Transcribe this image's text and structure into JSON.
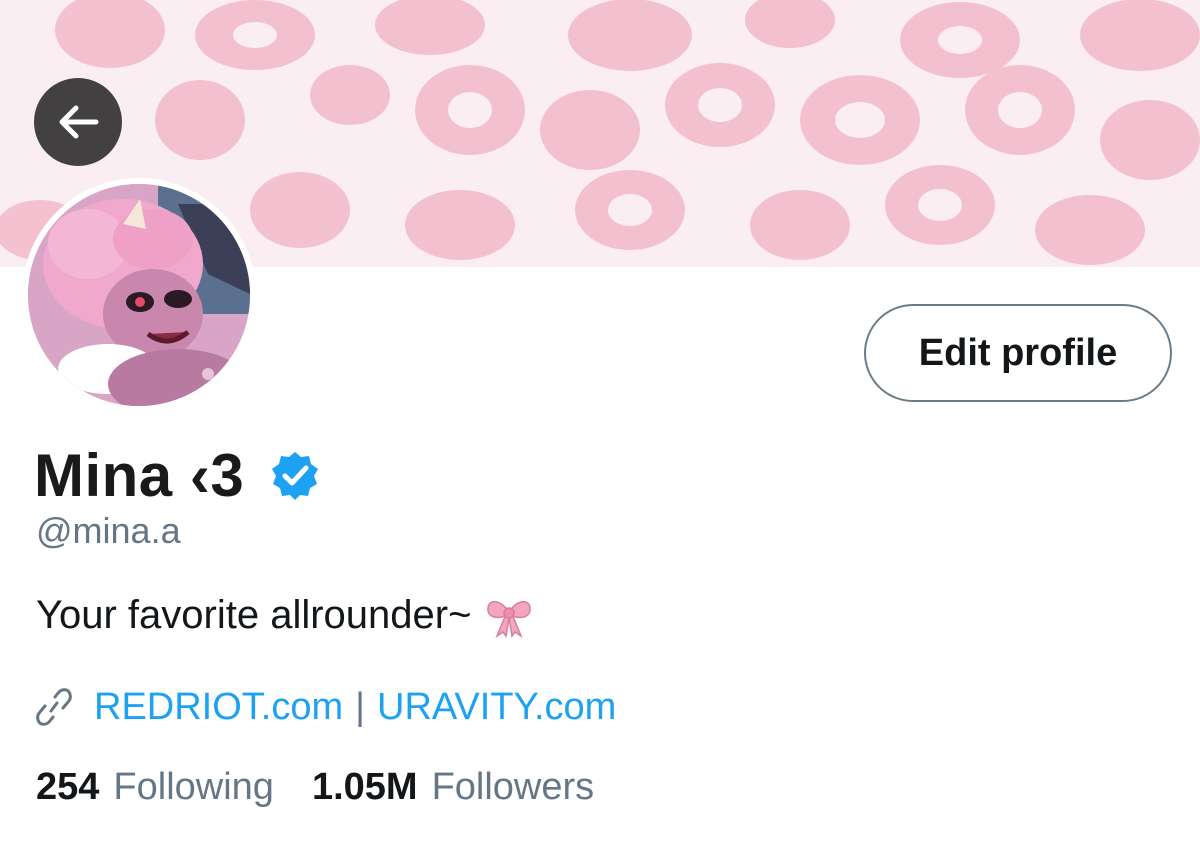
{
  "profile": {
    "display_name": "Mina ‹3",
    "handle": "@mina.a",
    "bio": "Your favorite allrounder~",
    "bio_emoji": "ribbon-icon",
    "links": [
      {
        "label": "REDRIOT.com"
      },
      {
        "label": "URAVITY.com"
      }
    ],
    "link_separator": "|",
    "following_count": "254",
    "following_label": "Following",
    "followers_count": "1.05M",
    "followers_label": "Followers"
  },
  "actions": {
    "edit_profile_label": "Edit profile"
  },
  "colors": {
    "link": "#1da1f2",
    "verified": "#1da1f2",
    "banner_base": "#fbeef2",
    "banner_spots": "#f2b8cb",
    "muted_text": "#657786"
  }
}
